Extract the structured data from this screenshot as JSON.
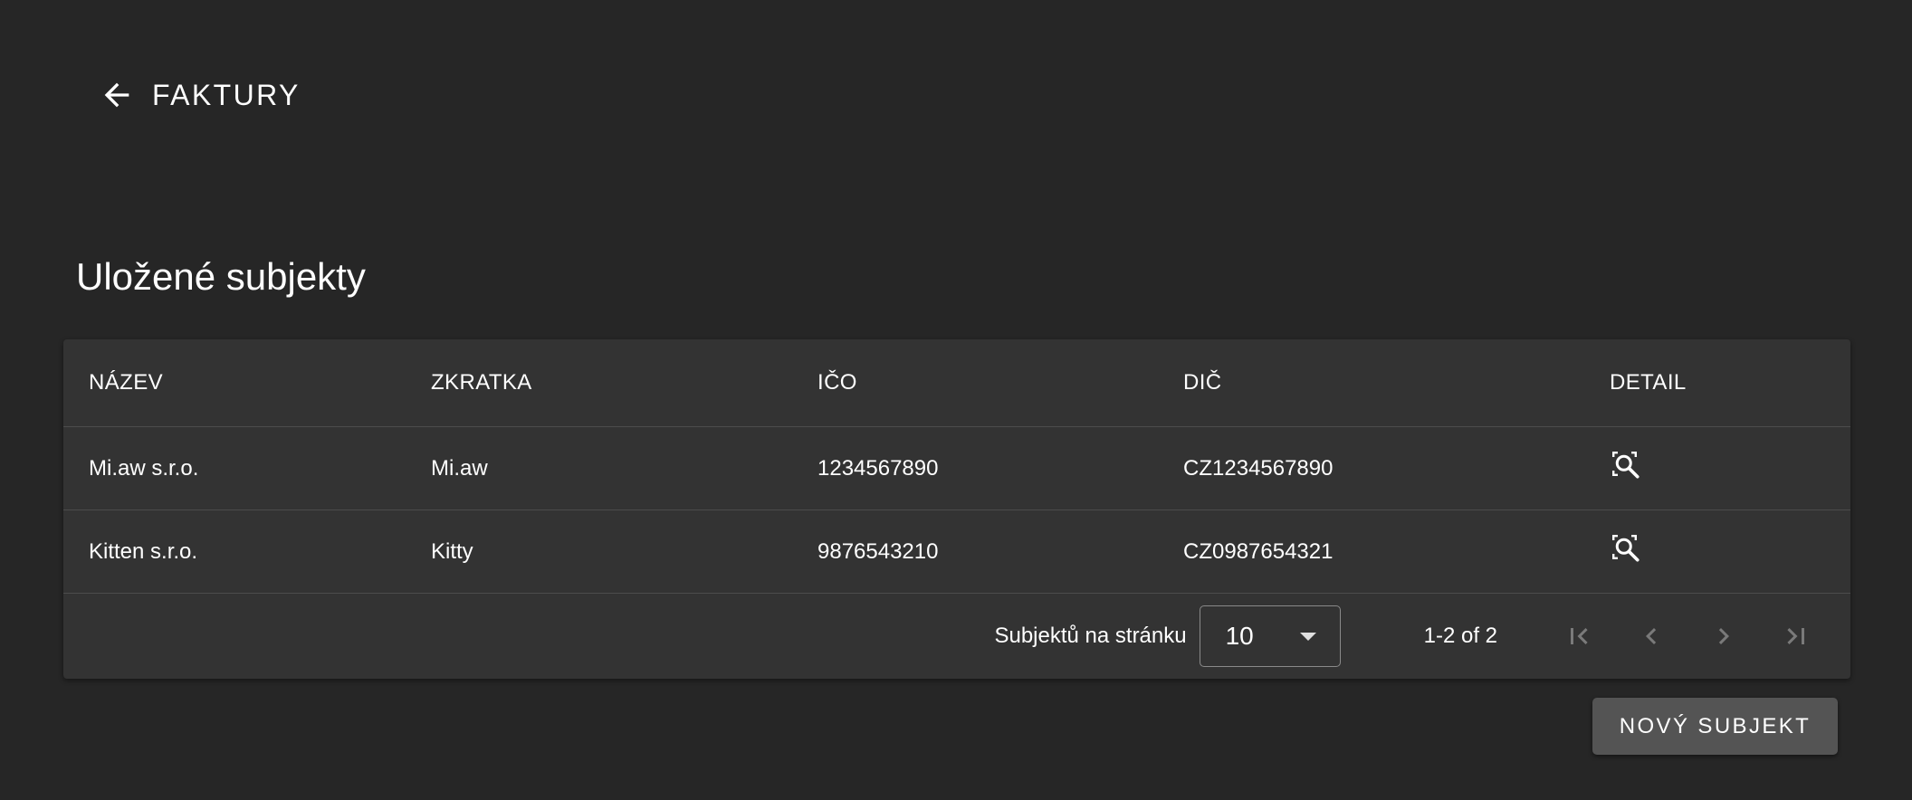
{
  "header": {
    "title": "FAKTURY",
    "back_icon": "arrow-left-icon"
  },
  "section": {
    "title": "Uložené subjekty"
  },
  "table": {
    "columns": [
      "NÁZEV",
      "ZKRATKA",
      "IČO",
      "DIČ",
      "DETAIL"
    ],
    "rows": [
      {
        "nazev": "Mi.aw s.r.o.",
        "zkratka": "Mi.aw",
        "ico": "1234567890",
        "dic": "CZ1234567890",
        "detail_icon": "search-detail-icon"
      },
      {
        "nazev": "Kitten s.r.o.",
        "zkratka": "Kitty",
        "ico": "9876543210",
        "dic": "CZ0987654321",
        "detail_icon": "search-detail-icon"
      }
    ]
  },
  "pagination": {
    "per_page_label": "Subjektů na stránku",
    "per_page_value": "10",
    "range": "1-2 of 2",
    "icons": [
      "first-page-icon",
      "prev-page-icon",
      "next-page-icon",
      "last-page-icon"
    ]
  },
  "actions": {
    "new_subject": "NOVÝ SUBJEKT"
  },
  "colors": {
    "background": "#262626",
    "card": "#333333",
    "button": "#545454",
    "text": "#ffffff",
    "disabled_icon": "#7a7a7a"
  }
}
